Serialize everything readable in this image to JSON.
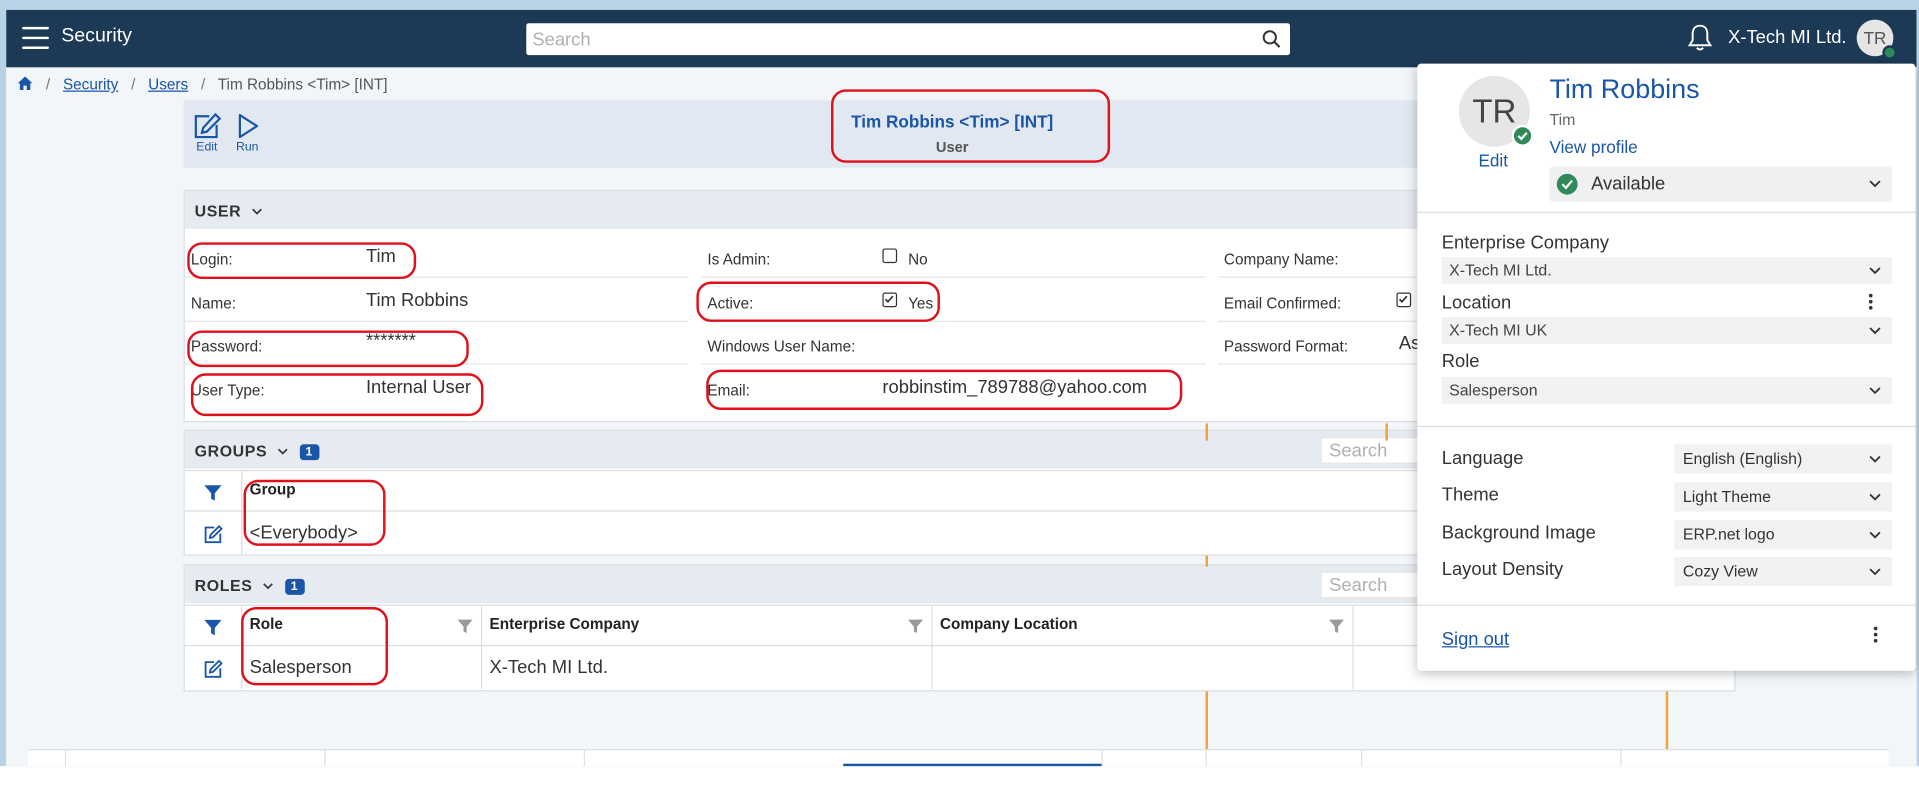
{
  "topbar": {
    "app_title": "Security",
    "search_placeholder": "Search",
    "company": "X-Tech MI Ltd.",
    "avatar_initials": "TR"
  },
  "breadcrumb": {
    "items": [
      "Security",
      "Users"
    ],
    "current": "Tim Robbins <Tim> [INT]"
  },
  "header": {
    "edit_label": "Edit",
    "run_label": "Run",
    "title": "Tim Robbins <Tim> [INT]",
    "subtitle": "User"
  },
  "user_section": {
    "title": "USER",
    "login_label": "Login:",
    "login_value": "Tim",
    "name_label": "Name:",
    "name_value": "Tim Robbins",
    "password_label": "Password:",
    "password_value": "*******",
    "user_type_label": "User Type:",
    "user_type_value": "Internal User",
    "is_admin_label": "Is Admin:",
    "is_admin_value": "No",
    "active_label": "Active:",
    "active_value": "Yes",
    "windows_user_label": "Windows User Name:",
    "email_label": "Email:",
    "email_value": "robbinstim_789788@yahoo.com",
    "company_name_label": "Company Name:",
    "email_confirmed_label": "Email Confirmed:",
    "password_format_label": "Password Format:",
    "password_format_value": "As"
  },
  "groups_section": {
    "title": "GROUPS",
    "count": "1",
    "search_placeholder": "Search",
    "column": "Group",
    "rows": [
      "<Everybody>"
    ]
  },
  "roles_section": {
    "title": "ROLES",
    "count": "1",
    "search_placeholder": "Search",
    "columns": [
      "Role",
      "Enterprise Company",
      "Company Location"
    ],
    "rows": [
      [
        "Salesperson",
        "X-Tech MI Ltd.",
        ""
      ]
    ]
  },
  "profile": {
    "initials": "TR",
    "edit_label": "Edit",
    "name": "Tim Robbins",
    "login": "Tim",
    "view_profile": "View profile",
    "status": "Available",
    "enterprise_company_label": "Enterprise Company",
    "enterprise_company_value": "X-Tech MI Ltd.",
    "location_label": "Location",
    "location_value": "X-Tech MI UK",
    "role_label": "Role",
    "role_value": "Salesperson",
    "language_label": "Language",
    "language_value": "English (English)",
    "theme_label": "Theme",
    "theme_value": "Light Theme",
    "background_label": "Background Image",
    "background_value": "ERP.net logo",
    "density_label": "Layout Density",
    "density_value": "Cozy View",
    "sign_out": "Sign out"
  },
  "colors": {
    "topbar": "#1c3a56",
    "accent": "#1a56a8",
    "annotation": "#e0101a",
    "status_green": "#2e8b57"
  }
}
